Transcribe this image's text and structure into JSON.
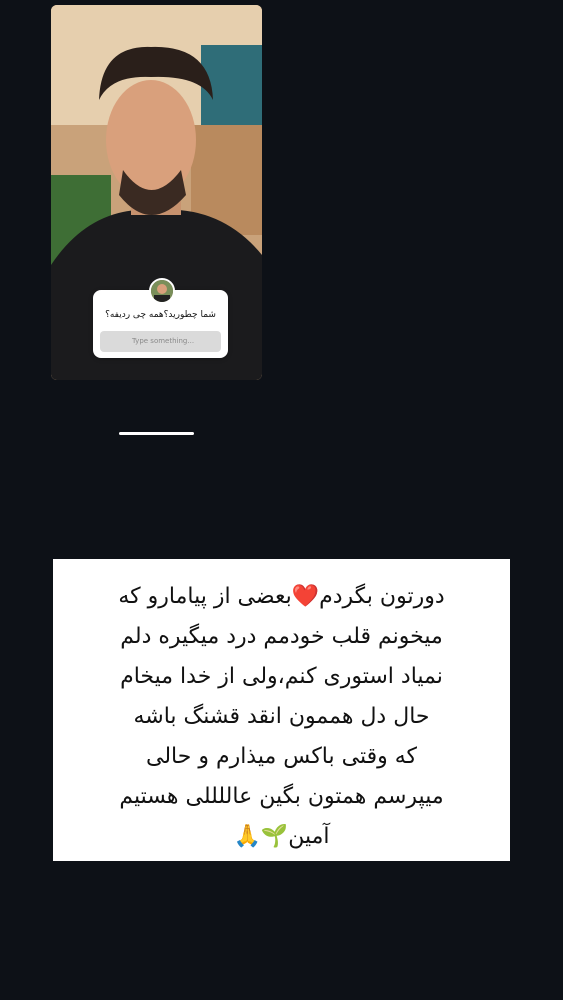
{
  "story": {
    "question_text": "شما چطورید؟همه چی ردیفه؟",
    "input_placeholder": "Type something..."
  },
  "caption": {
    "text": "دورتون بگردم❤️بعضی از پیامارو که\nمیخونم قلب خودمم درد میگیره دلم\nنمیاد استوری کنم،ولی از خدا میخام\nحال دل هممون انقد قشنگ باشه\nکه وقتی باکس میذارم و حالی\nمیپرسم همتون بگین عاللللی هستیم\nآمین🌱🙏"
  }
}
